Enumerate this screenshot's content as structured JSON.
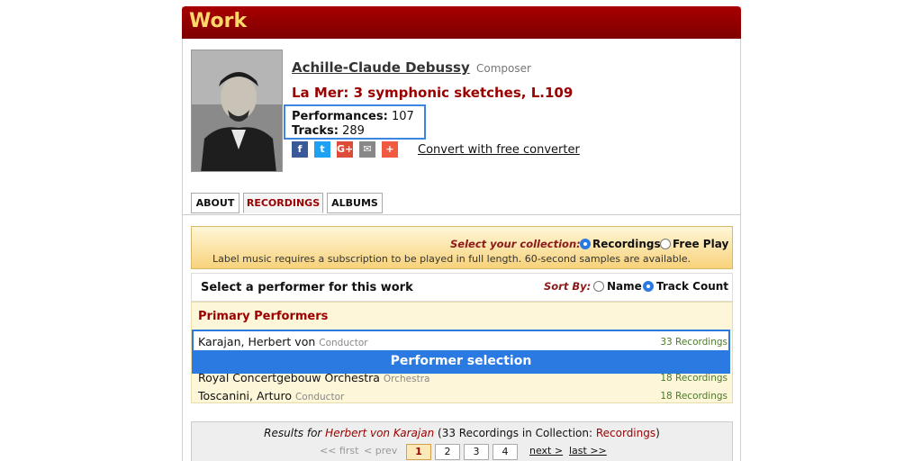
{
  "header": {
    "title": "Work"
  },
  "composer": {
    "name": "Achille-Claude Debussy",
    "role": "Composer"
  },
  "work": {
    "title": "La Mer: 3 symphonic sketches, L.109"
  },
  "stats": {
    "performances_label": "Performances:",
    "performances_value": "107",
    "tracks_label": "Tracks:",
    "tracks_value": "289"
  },
  "share": {
    "icons": [
      {
        "name": "facebook-icon",
        "glyph": "f",
        "color": "#3b5998"
      },
      {
        "name": "twitter-icon",
        "glyph": "t",
        "color": "#1da1f2"
      },
      {
        "name": "googleplus-icon",
        "glyph": "G+",
        "color": "#dd4b39"
      },
      {
        "name": "email-icon",
        "glyph": "✉",
        "color": "#888888"
      },
      {
        "name": "more-share-icon",
        "glyph": "+",
        "color": "#f05a40"
      }
    ],
    "convert_link": "Convert with free converter"
  },
  "tabs": [
    {
      "label": "ABOUT",
      "active": false
    },
    {
      "label": "RECORDINGS",
      "active": true
    },
    {
      "label": "ALBUMS",
      "active": false
    }
  ],
  "collection": {
    "label": "Select your collection:",
    "options": [
      {
        "label": "Recordings",
        "selected": true
      },
      {
        "label": "Free Play",
        "selected": false
      }
    ],
    "notice": "Label music requires a subscription to be played in full length. 60-second samples are available."
  },
  "performers": {
    "heading": "Select a performer for this work",
    "sort_label": "Sort By:",
    "sort_options": [
      {
        "label": "Name",
        "selected": false
      },
      {
        "label": "Track Count",
        "selected": true
      }
    ],
    "primary_title": "Primary Performers",
    "rows": [
      {
        "name": "Karajan, Herbert von",
        "role": "Conductor",
        "count": "33 Recordings"
      },
      {
        "name": "Royal Concertgebouw Orchestra",
        "role": "Orchestra",
        "count": "18 Recordings"
      },
      {
        "name": "Toscanini, Arturo",
        "role": "Conductor",
        "count": "18 Recordings"
      }
    ],
    "selection_banner": "Performer selection"
  },
  "results": {
    "prefix": "Results for ",
    "performer": "Herbert von Karajan",
    "middle": " (33 Recordings in Collection: ",
    "collection": "Recordings",
    "suffix": ")",
    "first": "<< first",
    "prev": "< prev",
    "pages": [
      "1",
      "2",
      "3",
      "4"
    ],
    "current_page": "1",
    "next": "next >",
    "last": "last >>"
  },
  "colors": {
    "accent_red": "#9b0000",
    "selection_blue": "#2a7ae2",
    "title_yellow": "#ffd76a"
  }
}
